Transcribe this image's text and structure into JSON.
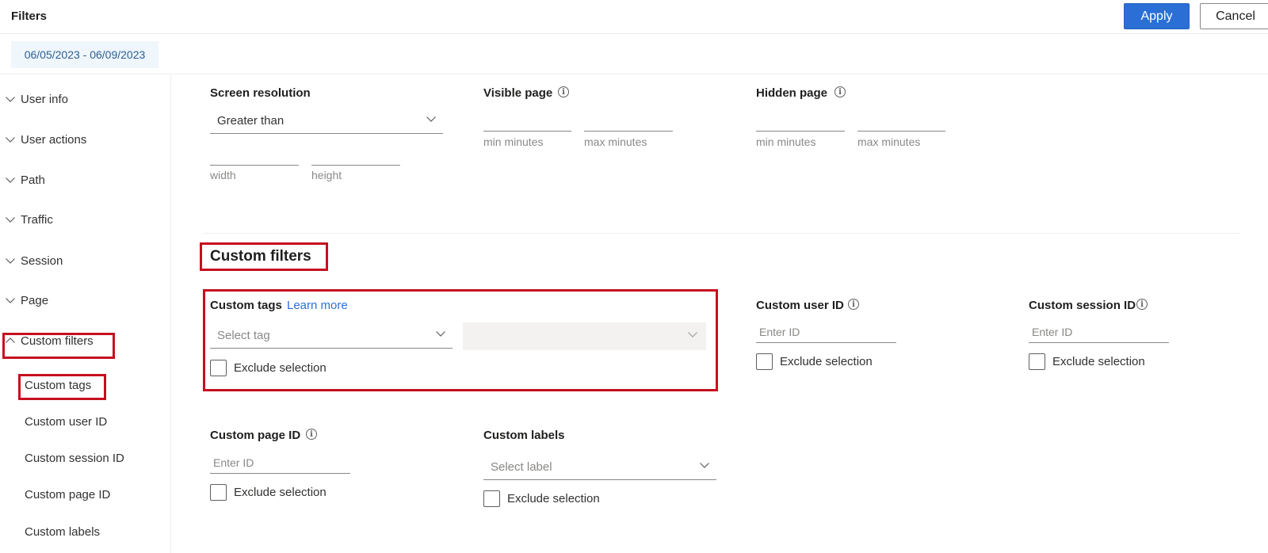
{
  "header": {
    "title": "Filters",
    "apply_label": "Apply",
    "cancel_label": "Cancel"
  },
  "date_range": "06/05/2023 - 06/09/2023",
  "sidebar": {
    "items": [
      {
        "label": "User info",
        "expanded": false
      },
      {
        "label": "User actions",
        "expanded": false
      },
      {
        "label": "Path",
        "expanded": false
      },
      {
        "label": "Traffic",
        "expanded": false
      },
      {
        "label": "Session",
        "expanded": false
      },
      {
        "label": "Page",
        "expanded": false
      },
      {
        "label": "Custom filters",
        "expanded": true
      }
    ],
    "sub_items": [
      {
        "label": "Custom tags"
      },
      {
        "label": "Custom user ID"
      },
      {
        "label": "Custom session ID"
      },
      {
        "label": "Custom page ID"
      },
      {
        "label": "Custom labels"
      }
    ]
  },
  "screen_resolution": {
    "label": "Screen resolution",
    "operator": "Greater than",
    "width_hint": "width",
    "height_hint": "height"
  },
  "visible_page": {
    "label": "Visible page",
    "min_hint": "min minutes",
    "max_hint": "max minutes"
  },
  "hidden_page": {
    "label": "Hidden page",
    "min_hint": "min minutes",
    "max_hint": "max minutes"
  },
  "custom_filters": {
    "title": "Custom filters",
    "custom_tags": {
      "label": "Custom tags",
      "learn_more": "Learn more",
      "tag_placeholder": "Select tag",
      "exclude_label": "Exclude selection",
      "exclude_checked": false
    },
    "custom_user_id": {
      "label": "Custom user ID",
      "placeholder": "Enter ID",
      "exclude_label": "Exclude selection",
      "exclude_checked": false
    },
    "custom_session_id": {
      "label": "Custom session ID",
      "placeholder": "Enter ID",
      "exclude_label": "Exclude selection",
      "exclude_checked": false
    },
    "custom_page_id": {
      "label": "Custom page ID",
      "placeholder": "Enter ID",
      "exclude_label": "Exclude selection",
      "exclude_checked": false
    },
    "custom_labels": {
      "label": "Custom labels",
      "placeholder": "Select label",
      "exclude_label": "Exclude selection",
      "exclude_checked": false
    }
  },
  "colors": {
    "accent": "#2b6fd6",
    "highlight_border": "#c50f1f",
    "date_chip_bg": "#eff6fc"
  }
}
